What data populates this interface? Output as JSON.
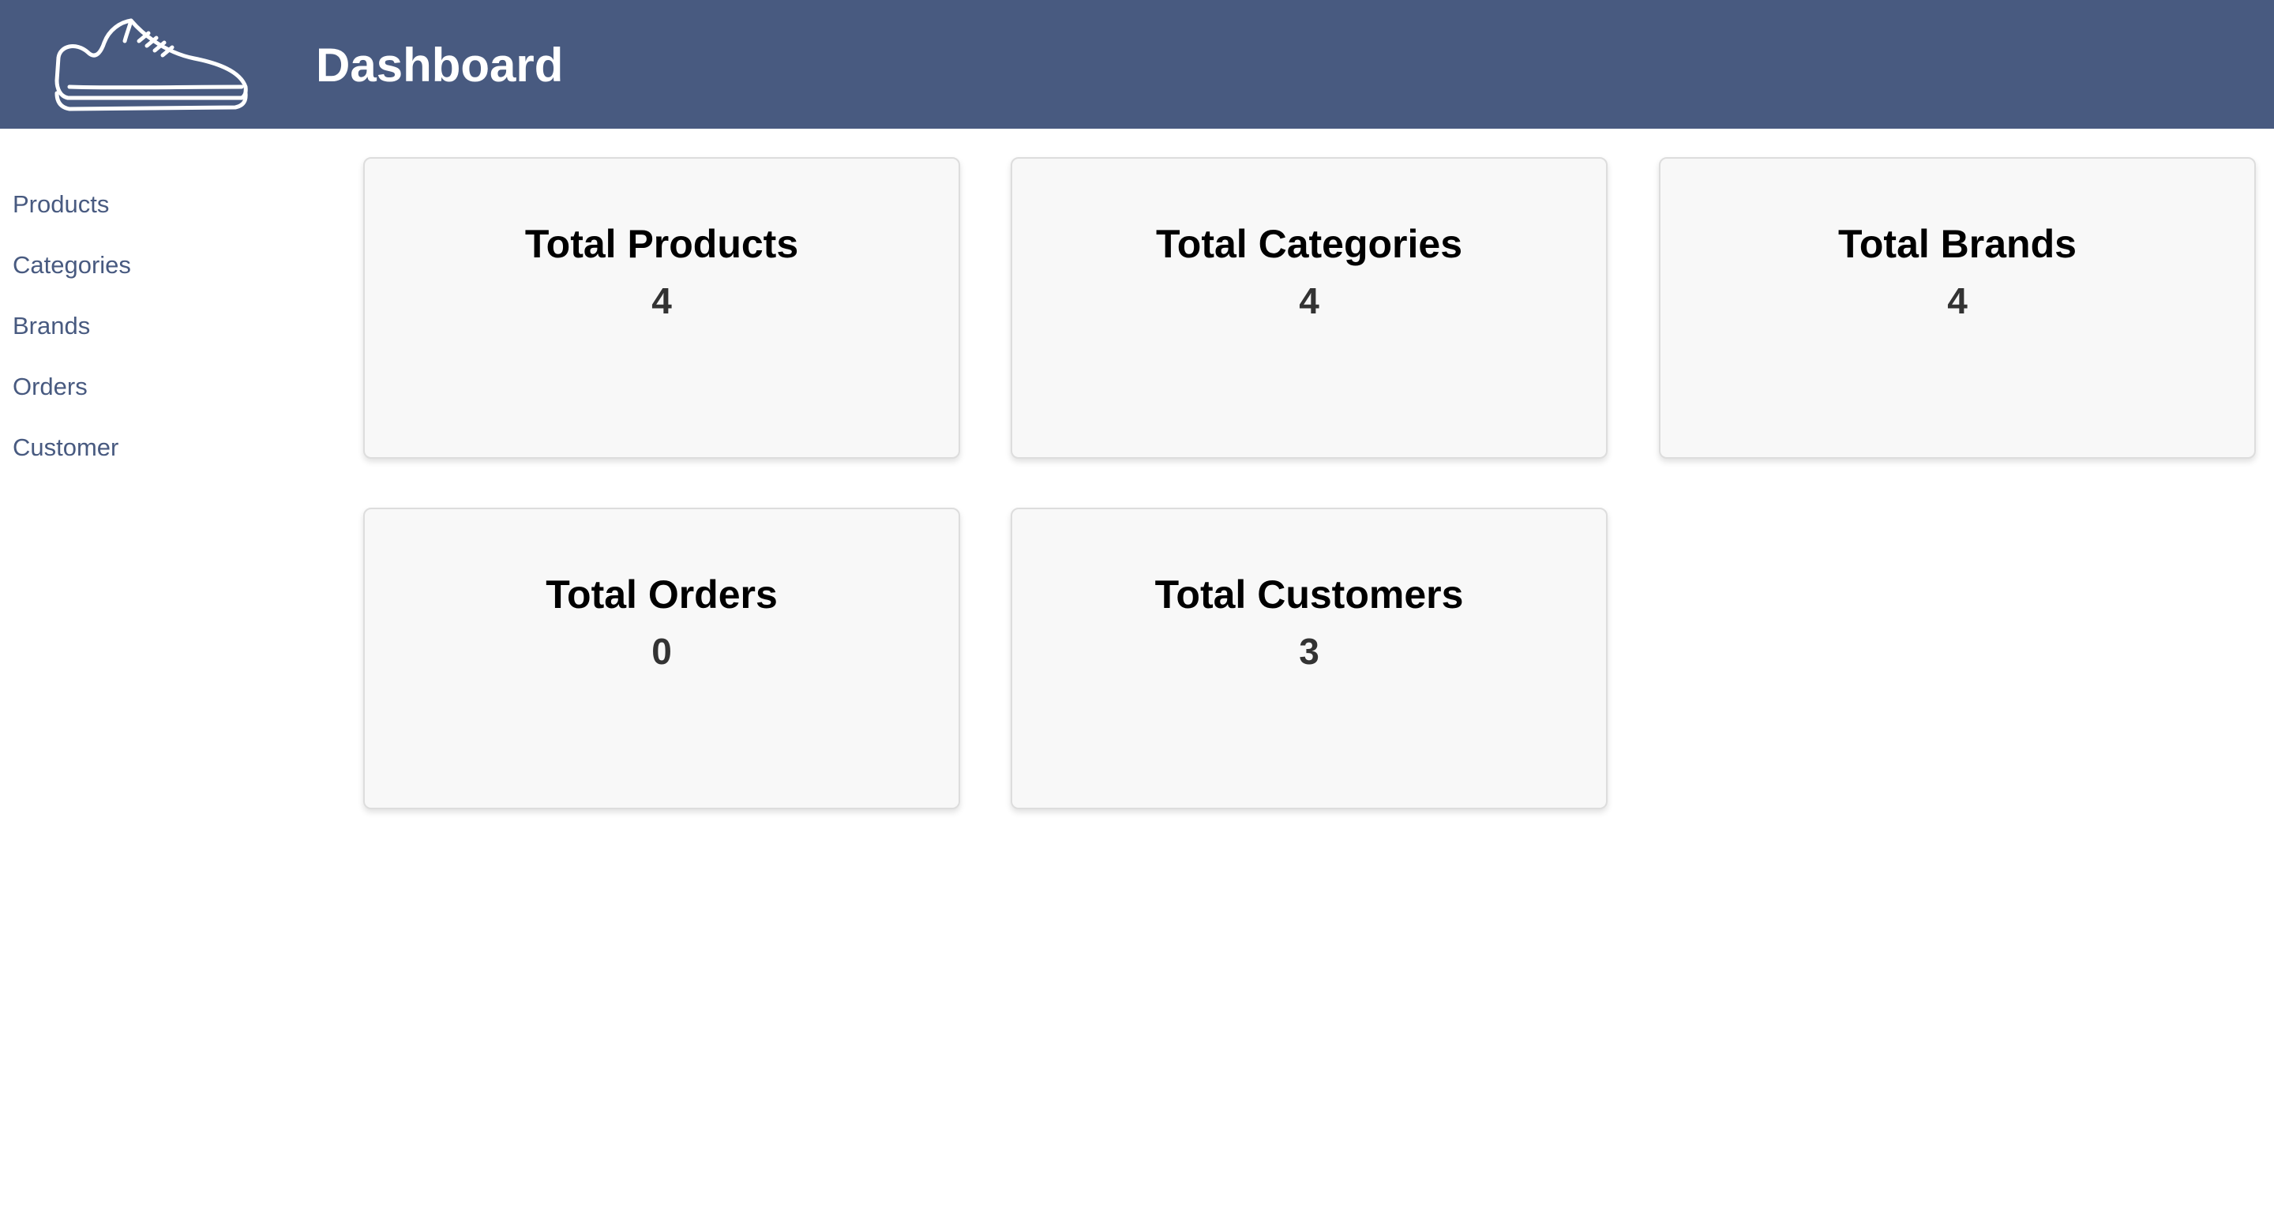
{
  "header": {
    "title": "Dashboard",
    "logo_icon": "sneaker-icon",
    "background": "#485a80"
  },
  "sidebar": {
    "items": [
      {
        "label": "Products"
      },
      {
        "label": "Categories"
      },
      {
        "label": "Brands"
      },
      {
        "label": "Orders"
      },
      {
        "label": "Customer"
      }
    ]
  },
  "cards": [
    {
      "title": "Total Products",
      "value": "4"
    },
    {
      "title": "Total Categories",
      "value": "4"
    },
    {
      "title": "Total Brands",
      "value": "4"
    },
    {
      "title": "Total Orders",
      "value": "0"
    },
    {
      "title": "Total Customers",
      "value": "3"
    }
  ]
}
